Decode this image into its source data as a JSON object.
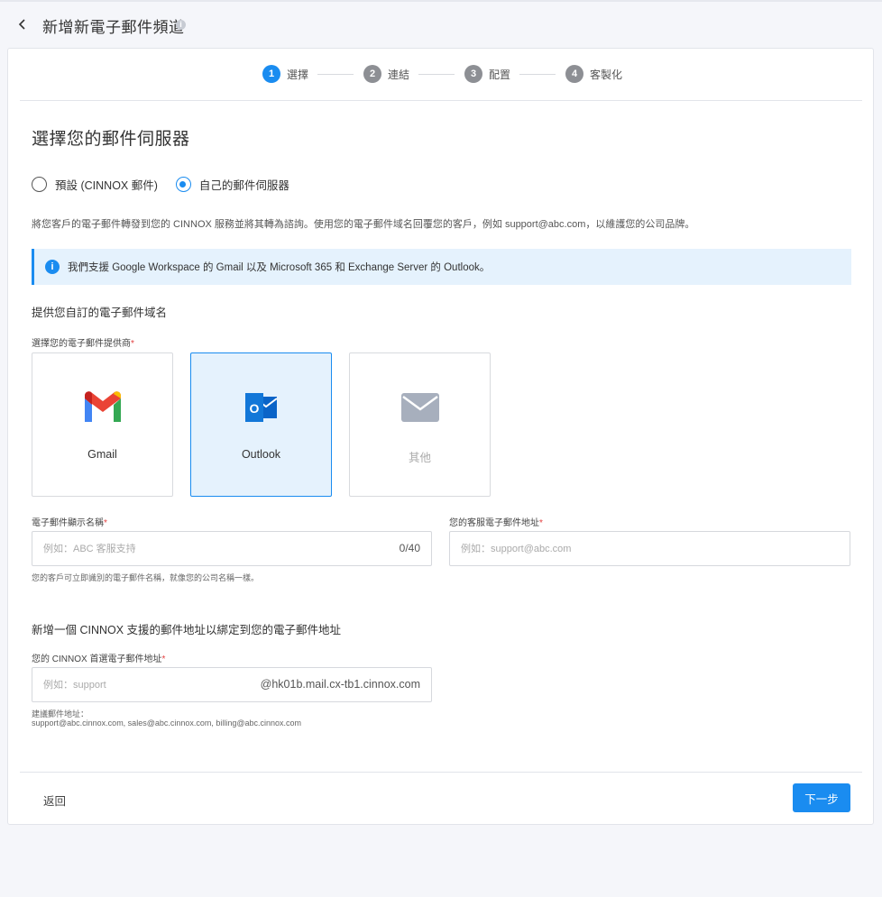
{
  "header": {
    "title": "新增新電子郵件頻道"
  },
  "stepper": {
    "steps": [
      {
        "num": "1",
        "label": "選擇",
        "active": true
      },
      {
        "num": "2",
        "label": "連結",
        "active": false
      },
      {
        "num": "3",
        "label": "配置",
        "active": false
      },
      {
        "num": "4",
        "label": "客製化",
        "active": false
      }
    ]
  },
  "main": {
    "section_title": "選擇您的郵件伺服器",
    "radio_options": [
      {
        "label": "預設 (CINNOX 郵件)",
        "checked": false
      },
      {
        "label": "自己的郵件伺服器",
        "checked": true
      }
    ],
    "description": "將您客戶的電子郵件轉發到您的 CINNOX 服務並將其轉為諮詢。使用您的電子郵件域名回覆您的客戶，例如 support@abc.com，以維護您的公司品牌。",
    "info_banner": "我們支援 Google Workspace 的 Gmail 以及 Microsoft 365 和 Exchange Server 的 Outlook。",
    "custom_domain_title": "提供您自訂的電子郵件域名",
    "provider_label": "選擇您的電子郵件提供商",
    "required_mark": "*",
    "providers": [
      {
        "name": "Gmail",
        "icon": "gmail-icon",
        "selected": false
      },
      {
        "name": "Outlook",
        "icon": "outlook-icon",
        "selected": true
      },
      {
        "name": "其他",
        "icon": "mail-icon",
        "selected": false
      }
    ],
    "display_name": {
      "label": "電子郵件顯示名稱",
      "placeholder": "例如：ABC 客服支持",
      "counter": "0/40",
      "helper": "您的客戶可立即識別的電子郵件名稱，就像您的公司名稱一樣。"
    },
    "support_email": {
      "label": "您的客服電子郵件地址",
      "placeholder": "例如：support@abc.com"
    },
    "bind_title": "新增一個 CINNOX 支援的郵件地址以綁定到您的電子郵件地址",
    "preferred_email": {
      "label": "您的 CINNOX 首選電子郵件地址",
      "placeholder": "例如：support",
      "suffix": "@hk01b.mail.cx-tb1.cinnox.com",
      "helper_title": "建議郵件地址：",
      "helper_list": "support@abc.cinnox.com, sales@abc.cinnox.com, billing@abc.cinnox.com"
    }
  },
  "footer": {
    "back_label": "返回",
    "next_label": "下一步"
  },
  "colors": {
    "accent": "#1a8cf0",
    "selected_bg": "#e5f2fd"
  }
}
